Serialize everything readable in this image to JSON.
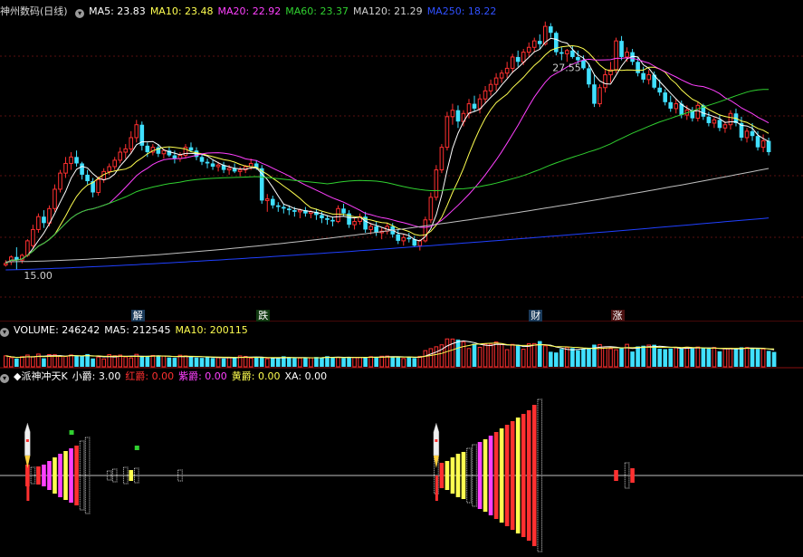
{
  "colors": {
    "up": "#ff3030",
    "down": "#40e0ff",
    "ma5": "#ffffff",
    "ma10": "#ffff50",
    "ma20": "#ff40ff",
    "ma60": "#30d030",
    "ma120": "#c0c0c0",
    "ma250": "#2040ff",
    "lo": "#30c8c8"
  },
  "icons": {
    "expand": "chevron-down-icon",
    "diamond": "diamond-icon"
  },
  "price_header": {
    "title": "神州数码(日线)",
    "items": [
      {
        "label": "MA5: 23.83",
        "color": "#ffffff"
      },
      {
        "label": "MA10: 23.48",
        "color": "#ffff50"
      },
      {
        "label": "MA20: 22.92",
        "color": "#ff40ff"
      },
      {
        "label": "MA60: 23.37",
        "color": "#30d030"
      },
      {
        "label": "MA120: 21.29",
        "color": "#d0d0d0"
      },
      {
        "label": "MA250: 18.22",
        "color": "#3050ff"
      }
    ]
  },
  "volume_header": {
    "items": [
      {
        "label": "VOLUME: 246242",
        "color": "#ffffff"
      },
      {
        "label": "MA5: 212545",
        "color": "#ffffff"
      },
      {
        "label": "MA10: 200115",
        "color": "#ffff50"
      }
    ]
  },
  "indicator_header": {
    "items": [
      {
        "label": "◆派神冲天K",
        "color": "#ffffff"
      },
      {
        "label": "小爵: 3.00",
        "color": "#ffffff"
      },
      {
        "label": "红爵: 0.00",
        "color": "#ff3030"
      },
      {
        "label": "紫爵: 0.00",
        "color": "#ff40ff"
      },
      {
        "label": "黄爵: 0.00",
        "color": "#ffff50"
      },
      {
        "label": "XA: 0.00",
        "color": "#ffffff"
      }
    ]
  },
  "events": [
    {
      "label": "解",
      "index": 24,
      "bg": "#1a3a5a",
      "color": "#ffffff"
    },
    {
      "label": "跌",
      "index": 47,
      "bg": "#103a10",
      "color": "#ffffff"
    },
    {
      "label": "财",
      "index": 97,
      "bg": "#1a3a5a",
      "color": "#ffffff"
    },
    {
      "label": "涨",
      "index": 112,
      "bg": "#4a1010",
      "color": "#ffffff"
    }
  ],
  "chart_data": [
    {
      "type": "candlestick",
      "title": "神州数码(日线)",
      "ylim": [
        13.2,
        30.5
      ],
      "annotations": [
        {
          "text": "27.55",
          "index": 99,
          "value": 27.55
        },
        {
          "text": "15.00",
          "index": 2,
          "value": 15.0
        }
      ],
      "candles": [
        [
          15.3,
          15.6,
          15.2,
          15.4
        ],
        [
          15.5,
          15.9,
          15.3,
          15.8
        ],
        [
          15.8,
          16.4,
          15.0,
          15.6
        ],
        [
          15.6,
          16.0,
          15.4,
          15.9
        ],
        [
          15.9,
          16.9,
          15.8,
          16.8
        ],
        [
          16.5,
          17.8,
          16.3,
          17.5
        ],
        [
          17.5,
          18.5,
          17.3,
          18.3
        ],
        [
          18.3,
          18.7,
          17.6,
          17.9
        ],
        [
          17.9,
          19.0,
          17.7,
          18.8
        ],
        [
          18.8,
          20.3,
          18.6,
          20.0
        ],
        [
          20.0,
          21.2,
          19.8,
          21.0
        ],
        [
          21.0,
          22.0,
          20.7,
          21.6
        ],
        [
          21.6,
          22.3,
          21.2,
          22.0
        ],
        [
          22.0,
          22.4,
          21.4,
          21.6
        ],
        [
          21.6,
          21.7,
          20.6,
          20.9
        ],
        [
          20.9,
          21.2,
          20.3,
          20.5
        ],
        [
          20.5,
          20.7,
          19.5,
          19.8
        ],
        [
          19.8,
          20.8,
          19.6,
          20.6
        ],
        [
          20.6,
          21.3,
          20.4,
          21.1
        ],
        [
          21.1,
          21.6,
          20.9,
          21.4
        ],
        [
          21.4,
          22.0,
          21.2,
          21.8
        ],
        [
          21.8,
          22.6,
          21.6,
          22.3
        ],
        [
          22.3,
          22.8,
          21.9,
          22.5
        ],
        [
          22.5,
          23.6,
          22.2,
          23.2
        ],
        [
          23.2,
          24.3,
          22.9,
          24.0
        ],
        [
          24.0,
          24.2,
          22.4,
          22.7
        ],
        [
          22.7,
          22.9,
          22.0,
          22.3
        ],
        [
          22.3,
          22.8,
          22.1,
          22.6
        ],
        [
          22.6,
          22.8,
          22.0,
          22.2
        ],
        [
          22.2,
          22.5,
          21.9,
          22.4
        ],
        [
          22.4,
          22.6,
          22.0,
          22.1
        ],
        [
          22.1,
          22.4,
          21.6,
          21.9
        ],
        [
          21.9,
          22.3,
          21.7,
          22.1
        ],
        [
          22.1,
          22.8,
          21.9,
          22.6
        ],
        [
          22.6,
          22.9,
          22.3,
          22.4
        ],
        [
          22.4,
          22.6,
          21.8,
          22.0
        ],
        [
          22.0,
          22.2,
          21.5,
          21.7
        ],
        [
          21.7,
          21.9,
          21.3,
          21.6
        ],
        [
          21.6,
          21.8,
          21.2,
          21.4
        ],
        [
          21.4,
          21.7,
          21.1,
          21.5
        ],
        [
          21.5,
          21.7,
          21.0,
          21.2
        ],
        [
          21.2,
          21.5,
          20.9,
          21.3
        ],
        [
          21.3,
          21.6,
          21.0,
          21.1
        ],
        [
          21.1,
          21.4,
          20.8,
          21.2
        ],
        [
          21.2,
          21.5,
          21.0,
          21.4
        ],
        [
          21.4,
          21.9,
          21.2,
          21.6
        ],
        [
          21.6,
          21.8,
          21.2,
          21.3
        ],
        [
          21.3,
          21.5,
          19.1,
          19.3
        ],
        [
          19.3,
          19.7,
          18.6,
          19.4
        ],
        [
          19.4,
          19.6,
          18.8,
          19.0
        ],
        [
          19.0,
          19.2,
          18.6,
          18.9
        ],
        [
          18.9,
          19.1,
          18.5,
          18.8
        ],
        [
          18.8,
          19.0,
          18.4,
          18.7
        ],
        [
          18.7,
          18.9,
          18.3,
          18.6
        ],
        [
          18.6,
          18.8,
          18.2,
          18.7
        ],
        [
          18.7,
          18.9,
          18.3,
          18.5
        ],
        [
          18.5,
          18.7,
          18.2,
          18.6
        ],
        [
          18.6,
          18.8,
          18.1,
          18.4
        ],
        [
          18.4,
          18.6,
          17.9,
          18.2
        ],
        [
          18.2,
          18.4,
          17.8,
          18.1
        ],
        [
          18.1,
          18.3,
          17.7,
          18.0
        ],
        [
          18.0,
          19.0,
          17.9,
          18.8
        ],
        [
          18.8,
          19.1,
          18.3,
          18.5
        ],
        [
          18.5,
          18.7,
          17.6,
          17.8
        ],
        [
          17.8,
          18.2,
          17.5,
          18.0
        ],
        [
          18.0,
          18.5,
          17.8,
          18.3
        ],
        [
          18.3,
          18.6,
          17.3,
          17.5
        ],
        [
          17.5,
          17.9,
          17.2,
          17.7
        ],
        [
          17.7,
          18.0,
          17.1,
          17.3
        ],
        [
          17.3,
          17.6,
          16.9,
          17.4
        ],
        [
          17.4,
          17.9,
          17.2,
          17.7
        ],
        [
          17.7,
          17.9,
          17.0,
          17.2
        ],
        [
          17.2,
          17.5,
          16.6,
          16.8
        ],
        [
          16.8,
          17.2,
          16.5,
          17.0
        ],
        [
          17.0,
          17.3,
          16.7,
          16.9
        ],
        [
          16.9,
          17.1,
          16.4,
          16.5
        ],
        [
          16.5,
          16.9,
          16.2,
          16.8
        ],
        [
          16.8,
          18.3,
          16.7,
          18.1
        ],
        [
          18.1,
          19.8,
          17.9,
          19.5
        ],
        [
          19.5,
          21.5,
          19.3,
          21.2
        ],
        [
          21.2,
          22.8,
          21.0,
          22.6
        ],
        [
          22.6,
          24.8,
          22.4,
          24.5
        ],
        [
          24.5,
          25.3,
          24.0,
          24.9
        ],
        [
          24.9,
          25.2,
          23.8,
          24.2
        ],
        [
          24.2,
          24.9,
          23.9,
          24.7
        ],
        [
          24.7,
          25.6,
          24.4,
          25.3
        ],
        [
          25.3,
          25.8,
          24.8,
          25.0
        ],
        [
          25.0,
          25.9,
          24.7,
          25.6
        ],
        [
          25.6,
          26.4,
          25.3,
          26.1
        ],
        [
          26.1,
          26.8,
          25.8,
          26.5
        ],
        [
          26.5,
          27.2,
          26.1,
          26.9
        ],
        [
          26.9,
          27.4,
          26.6,
          27.2
        ],
        [
          27.2,
          27.9,
          26.9,
          27.5
        ],
        [
          27.5,
          28.4,
          27.2,
          28.2
        ],
        [
          28.2,
          28.6,
          27.6,
          27.9
        ],
        [
          27.9,
          28.7,
          27.7,
          28.5
        ],
        [
          28.5,
          29.1,
          28.2,
          28.8
        ],
        [
          28.8,
          29.4,
          28.5,
          29.2
        ],
        [
          29.2,
          29.6,
          28.7,
          29.0
        ],
        [
          29.0,
          30.4,
          28.9,
          30.1
        ],
        [
          30.1,
          30.3,
          29.4,
          29.7
        ],
        [
          29.7,
          29.8,
          28.3,
          28.5
        ],
        [
          28.5,
          28.8,
          28.0,
          28.4
        ],
        [
          28.4,
          28.7,
          27.9,
          28.6
        ],
        [
          28.6,
          28.9,
          28.1,
          28.2
        ],
        [
          28.2,
          28.6,
          27.8,
          28.0
        ],
        [
          28.0,
          28.3,
          27.4,
          27.5
        ],
        [
          27.5,
          27.8,
          26.3,
          26.5
        ],
        [
          26.5,
          27.1,
          25.1,
          25.3
        ],
        [
          25.3,
          26.5,
          25.1,
          26.3
        ],
        [
          26.3,
          27.4,
          26.0,
          27.1
        ],
        [
          27.1,
          27.9,
          26.6,
          27.4
        ],
        [
          27.4,
          29.4,
          27.2,
          29.2
        ],
        [
          29.2,
          29.5,
          28.0,
          28.2
        ],
        [
          28.2,
          28.8,
          27.9,
          28.5
        ],
        [
          28.5,
          28.7,
          27.7,
          27.9
        ],
        [
          27.9,
          28.2,
          27.0,
          27.2
        ],
        [
          27.2,
          27.6,
          26.6,
          26.8
        ],
        [
          26.8,
          27.4,
          26.5,
          27.1
        ],
        [
          27.1,
          27.3,
          26.2,
          26.3
        ],
        [
          26.3,
          26.8,
          25.8,
          26.0
        ],
        [
          26.0,
          26.2,
          25.2,
          25.4
        ],
        [
          25.4,
          25.8,
          24.8,
          25.0
        ],
        [
          25.0,
          25.6,
          24.7,
          25.3
        ],
        [
          25.3,
          25.5,
          24.4,
          24.6
        ],
        [
          24.6,
          25.2,
          24.3,
          24.9
        ],
        [
          24.9,
          25.1,
          24.2,
          24.4
        ],
        [
          24.4,
          25.4,
          24.2,
          25.2
        ],
        [
          25.2,
          25.3,
          24.3,
          24.5
        ],
        [
          24.5,
          24.8,
          23.9,
          24.1
        ],
        [
          24.1,
          24.5,
          23.8,
          24.3
        ],
        [
          24.3,
          24.6,
          23.6,
          23.8
        ],
        [
          23.8,
          24.2,
          23.5,
          24.0
        ],
        [
          24.0,
          24.9,
          23.7,
          24.7
        ],
        [
          24.7,
          25.0,
          23.9,
          24.1
        ],
        [
          24.1,
          24.5,
          23.0,
          23.2
        ],
        [
          23.2,
          23.8,
          22.9,
          23.6
        ],
        [
          23.6,
          24.1,
          23.0,
          23.3
        ],
        [
          23.3,
          23.6,
          22.4,
          22.6
        ],
        [
          22.6,
          23.4,
          22.3,
          23.0
        ],
        [
          23.0,
          23.2,
          22.1,
          22.3
        ]
      ],
      "ma": {
        "ma120": {
          "start": 15.5,
          "end": 21.29
        },
        "ma250": {
          "start": 15.0,
          "end": 18.22
        }
      }
    },
    {
      "type": "bar",
      "title": "VOLUME",
      "values": [
        182000,
        151000,
        137000,
        168000,
        195000,
        168000,
        211000,
        141000,
        203000,
        200000,
        173000,
        171000,
        196000,
        179000,
        180000,
        211000,
        138000,
        162000,
        131000,
        201000,
        183000,
        194000,
        164000,
        147000,
        207000,
        169000,
        181000,
        188000,
        173000,
        180000,
        155000,
        149000,
        192000,
        181000,
        166000,
        154000,
        148000,
        171000,
        145000,
        151000,
        137000,
        149000,
        165000,
        180000,
        172000,
        143000,
        159000,
        151000,
        134000,
        144000,
        142000,
        174000,
        160000,
        143000,
        145000,
        154000,
        147000,
        163000,
        150000,
        176000,
        155000,
        158000,
        147000,
        156000,
        157000,
        157000,
        154000,
        168000,
        157000,
        175000,
        178000,
        170000,
        168000,
        137000,
        167000,
        145000,
        173000,
        268000,
        301000,
        332000,
        364000,
        462000,
        460000,
        451000,
        409000,
        303000,
        383000,
        323000,
        375000,
        373000,
        411000,
        368000,
        284000,
        371000,
        365000,
        291000,
        381000,
        385000,
        426000,
        348000,
        249000,
        237000,
        296000,
        321000,
        310000,
        274000,
        292000,
        316000,
        367000,
        369000,
        312000,
        300000,
        283000,
        307000,
        373000,
        253000,
        338000,
        349000,
        360000,
        365000,
        299000,
        292000,
        304000,
        319000,
        300000,
        325000,
        304000,
        328000,
        307000,
        304000,
        320000,
        256000,
        305000,
        308000,
        304000,
        323000,
        319000,
        303000,
        297000,
        296000,
        264000,
        246242
      ],
      "ma5_last": 212545,
      "ma10_last": 200115
    },
    {
      "type": "bar",
      "title": "派神冲天K",
      "values_xiaojue": 3.0,
      "values_hongjue": 0.0,
      "values_zijue": 0.0,
      "values_huangjue": 0.0,
      "values_xa": 0.0
    }
  ]
}
